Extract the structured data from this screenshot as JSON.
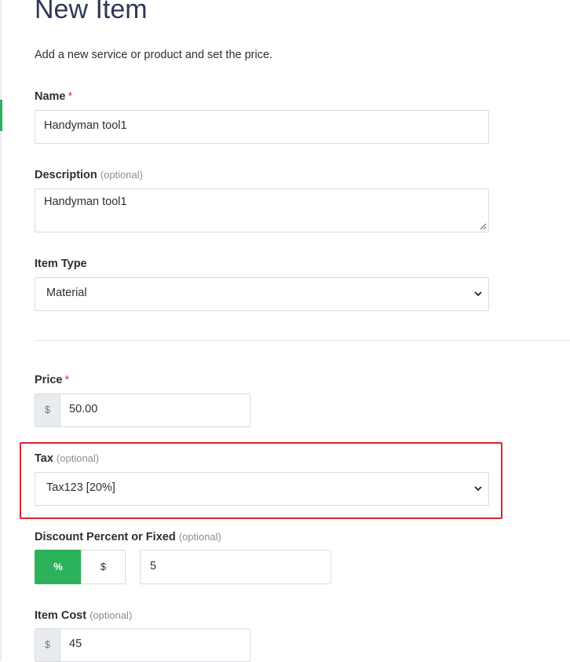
{
  "page": {
    "title": "New Item",
    "subtitle": "Add a new service or product and set the price."
  },
  "form": {
    "name": {
      "label": "Name",
      "required_mark": "*",
      "value": "Handyman tool1"
    },
    "description": {
      "label": "Description",
      "optional": "(optional)",
      "value": "Handyman tool1"
    },
    "item_type": {
      "label": "Item Type",
      "selected": "Material"
    },
    "price": {
      "label": "Price",
      "required_mark": "*",
      "currency": "$",
      "value": "50.00"
    },
    "tax": {
      "label": "Tax",
      "optional": "(optional)",
      "selected": "Tax123 [20%]"
    },
    "discount": {
      "label": "Discount Percent or Fixed",
      "optional": "(optional)",
      "percent_label": "%",
      "fixed_label": "$",
      "active": "percent",
      "value": "5"
    },
    "item_cost": {
      "label": "Item Cost",
      "optional": "(optional)",
      "currency": "$",
      "value": "45"
    }
  },
  "colors": {
    "accent": "#2db25c",
    "highlight_border": "#d9262e",
    "required": "#dc3545"
  }
}
